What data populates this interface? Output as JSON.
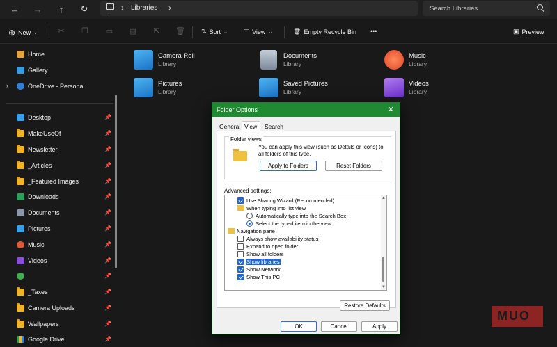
{
  "window": {
    "title": "Libraries"
  },
  "address": {
    "crumb": "Libraries"
  },
  "search": {
    "placeholder": "Search Libraries"
  },
  "commands": {
    "new": "New",
    "sort": "Sort",
    "view": "View",
    "empty_bin": "Empty Recycle Bin",
    "more": "•••",
    "preview": "Preview"
  },
  "sidebar": {
    "top": [
      {
        "label": "Home",
        "icon": "home-icon"
      },
      {
        "label": "Gallery",
        "icon": "gallery-icon"
      },
      {
        "label": "OneDrive - Personal",
        "icon": "cloud-icon"
      }
    ],
    "pinned": [
      {
        "label": "Desktop",
        "icon": "desktop-icon"
      },
      {
        "label": "MakeUseOf",
        "icon": "folder-icon"
      },
      {
        "label": "Newsletter",
        "icon": "folder-icon"
      },
      {
        "label": "_Articles",
        "icon": "folder-icon"
      },
      {
        "label": "_Featured Images",
        "icon": "folder-icon"
      },
      {
        "label": "Downloads",
        "icon": "download-icon"
      },
      {
        "label": "Documents",
        "icon": "documents-icon"
      },
      {
        "label": "Pictures",
        "icon": "pictures-icon"
      },
      {
        "label": "Music",
        "icon": "music-icon"
      },
      {
        "label": "Videos",
        "icon": "videos-icon"
      },
      {
        "label": "",
        "icon": "drive-icon"
      },
      {
        "label": "_Taxes",
        "icon": "folder-icon"
      },
      {
        "label": "Camera Uploads",
        "icon": "folder-icon"
      },
      {
        "label": "Wallpapers",
        "icon": "folder-icon"
      },
      {
        "label": "Google Drive",
        "icon": "google-drive-icon"
      }
    ]
  },
  "libraries": [
    {
      "name": "Camera Roll",
      "type": "Library",
      "icon": "camera-roll-icon"
    },
    {
      "name": "Documents",
      "type": "Library",
      "icon": "documents-library-icon"
    },
    {
      "name": "Music",
      "type": "Library",
      "icon": "music-library-icon"
    },
    {
      "name": "Pictures",
      "type": "Library",
      "icon": "pictures-library-icon"
    },
    {
      "name": "Saved Pictures",
      "type": "Library",
      "icon": "saved-pictures-icon"
    },
    {
      "name": "Videos",
      "type": "Library",
      "icon": "videos-library-icon"
    }
  ],
  "dialog": {
    "title": "Folder Options",
    "tabs": [
      "General",
      "View",
      "Search"
    ],
    "active_tab": "View",
    "folder_views": {
      "heading": "Folder views",
      "text": "You can apply this view (such as Details or Icons) to all folders of this type.",
      "apply_btn": "Apply to Folders",
      "reset_btn": "Reset Folders"
    },
    "advanced_label": "Advanced settings:",
    "advanced": [
      {
        "kind": "checkbox",
        "checked": true,
        "label": "Use Sharing Wizard (Recommended)",
        "indent": 1
      },
      {
        "kind": "folder",
        "label": "When typing into list view",
        "indent": 1
      },
      {
        "kind": "radio",
        "checked": false,
        "label": "Automatically type into the Search Box",
        "indent": 2
      },
      {
        "kind": "radio",
        "checked": true,
        "label": "Select the typed item in the view",
        "indent": 2
      },
      {
        "kind": "nav",
        "label": "Navigation pane",
        "indent": 0
      },
      {
        "kind": "checkbox",
        "checked": false,
        "label": "Always show availability status",
        "indent": 1
      },
      {
        "kind": "checkbox",
        "checked": false,
        "label": "Expand to open folder",
        "indent": 1
      },
      {
        "kind": "checkbox",
        "checked": false,
        "label": "Show all folders",
        "indent": 1
      },
      {
        "kind": "checkbox",
        "checked": true,
        "label": "Show libraries",
        "indent": 1,
        "selected": true
      },
      {
        "kind": "checkbox",
        "checked": true,
        "label": "Show Network",
        "indent": 1
      },
      {
        "kind": "checkbox",
        "checked": true,
        "label": "Show This PC",
        "indent": 1
      }
    ],
    "restore_btn": "Restore Defaults",
    "ok_btn": "OK",
    "cancel_btn": "Cancel",
    "apply_btn": "Apply"
  },
  "watermark": {
    "text": "MUO"
  },
  "colors": {
    "accent": "#1f8a32",
    "check": "#1f66d1",
    "folder": "#f0b429"
  }
}
